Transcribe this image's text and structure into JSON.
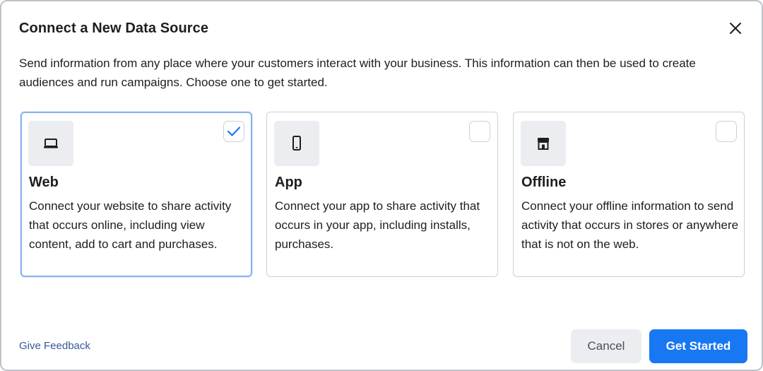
{
  "dialog": {
    "title": "Connect a New Data Source",
    "description": "Send information from any place where your customers interact with your business. This information can then be used to create audiences and run campaigns. Choose one to get started.",
    "close_icon": "close-icon"
  },
  "sources": [
    {
      "title": "Web",
      "description": "Connect your website to share activity that occurs online, including view content, add to cart and purchases.",
      "icon": "laptop-icon",
      "selected": true
    },
    {
      "title": "App",
      "description": "Connect your app to share activity that occurs in your app, including installs, purchases.",
      "icon": "mobile-phone-icon",
      "selected": false
    },
    {
      "title": "Offline",
      "description": "Connect your offline information to send activity that occurs in stores or anywhere that is not on the web.",
      "icon": "store-icon",
      "selected": false
    }
  ],
  "footer": {
    "feedback_link": "Give Feedback",
    "cancel_label": "Cancel",
    "primary_label": "Get Started"
  },
  "colors": {
    "accent": "#1877f2",
    "link": "#385898",
    "selected_border": "#8ab0ee",
    "icon_tile": "#ebedf0"
  }
}
